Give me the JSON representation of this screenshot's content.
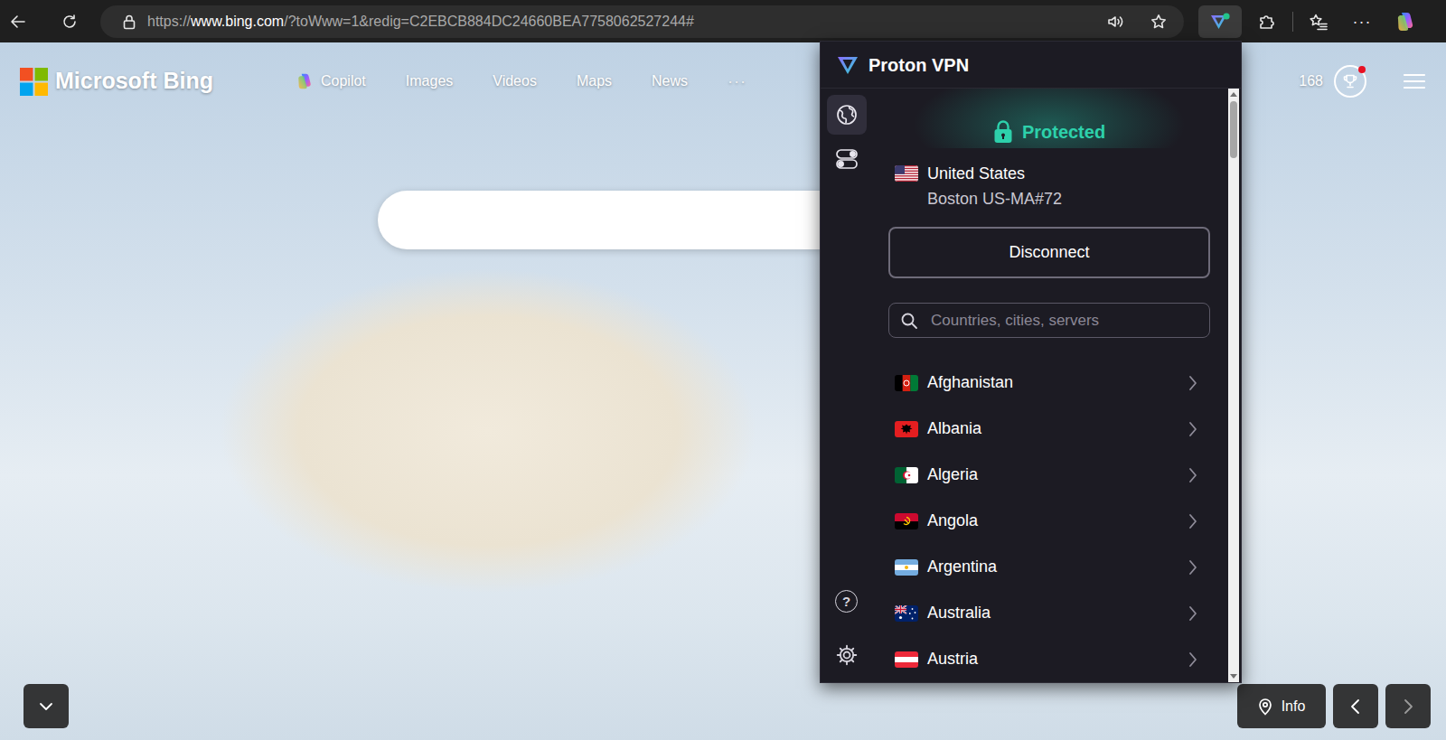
{
  "browser": {
    "url": {
      "scheme": "https://",
      "host": "www.bing.com",
      "rest": "/?toWww=1&redig=C2EBCB884DC24660BEA7758062527244#"
    },
    "more_menu": "···",
    "vpn_extension_open": true
  },
  "bing": {
    "logo": "Microsoft Bing",
    "nav": [
      {
        "label": "Copilot",
        "kind": "app"
      },
      {
        "label": "Images",
        "kind": "link"
      },
      {
        "label": "Videos",
        "kind": "link"
      },
      {
        "label": "Maps",
        "kind": "link"
      },
      {
        "label": "News",
        "kind": "link"
      },
      {
        "label": "···",
        "kind": "more"
      }
    ],
    "rewards": {
      "points": "168",
      "notification": true
    },
    "info_button": "Info"
  },
  "vpn": {
    "title": "Proton VPN",
    "tabs": [
      {
        "kind": "globe",
        "selected": true
      },
      {
        "kind": "toggles",
        "selected": false
      }
    ],
    "help_icon": "?",
    "status": "Protected",
    "connected": true,
    "location": {
      "country": "United States",
      "server": "Boston US-MA#72"
    },
    "disconnect": "Disconnect",
    "search": {
      "placeholder": "Countries, cities, servers"
    },
    "countries": [
      {
        "name": "Afghanistan"
      },
      {
        "name": "Albania"
      },
      {
        "name": "Algeria"
      },
      {
        "name": "Angola"
      },
      {
        "name": "Argentina"
      },
      {
        "name": "Australia"
      },
      {
        "name": "Austria"
      }
    ],
    "scrollbar": {
      "level": 0.1
    }
  }
}
